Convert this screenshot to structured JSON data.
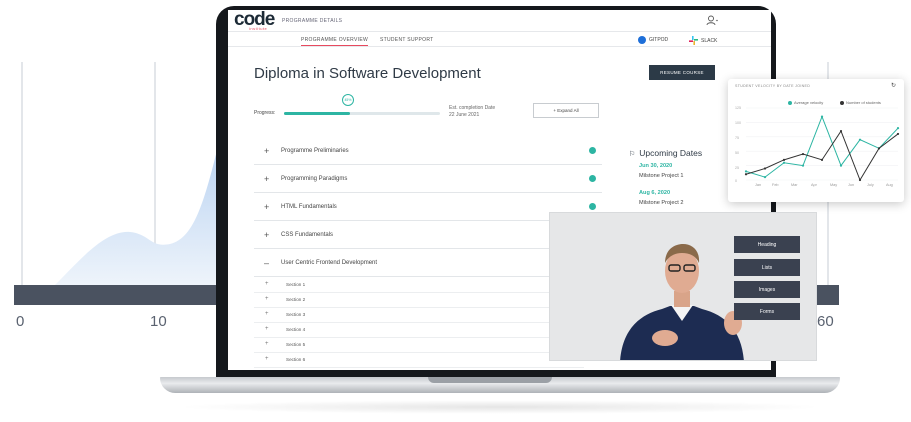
{
  "background_chart": {
    "axis_labels": [
      "0",
      "10",
      "60"
    ],
    "fill_color": "#c6d9f2",
    "band_color": "#4a5260"
  },
  "app": {
    "logo_text": "code",
    "logo_sub": "institute",
    "header_title": "PROGRAMME DETAILS",
    "user_icon": "user-icon"
  },
  "subnav": {
    "tabs": [
      "PROGRAMME OVERVIEW",
      "STUDENT SUPPORT"
    ],
    "active_tab": "PROGRAMME OVERVIEW",
    "gitpod": "GITPOD",
    "slack": "SLACK"
  },
  "main": {
    "title": "Diploma in Software Development",
    "resume_button": "RESUME COURSE",
    "progress_label": "Progress:",
    "progress_value": "45%",
    "progress_fraction": 0.42,
    "est_label": "Est. completion Date",
    "est_date": "22 June 2021",
    "expand_button": "+ Expand All",
    "modules": [
      {
        "name": "Programme Preliminaries",
        "complete": true
      },
      {
        "name": "Programming Paradigms",
        "complete": true
      },
      {
        "name": "HTML Fundamentals",
        "complete": true
      },
      {
        "name": "CSS Fundamentals",
        "complete": false
      },
      {
        "name": "User Centric Frontend Development",
        "complete": false,
        "expanded": true
      }
    ],
    "sections": [
      "Section 1",
      "Section 2",
      "Section 3",
      "Section 4",
      "Section 5",
      "Section 6"
    ]
  },
  "upcoming": {
    "title": "Upcoming Dates",
    "items": [
      {
        "date": "Jun 30, 2020",
        "label": "Milstone Project 1"
      },
      {
        "date": "Aug 6, 2020",
        "label": "Milstone Project 2"
      }
    ]
  },
  "velocity_card": {
    "title": "STUDENT VELOCITY BY DATE JOINED",
    "refresh_icon": "refresh-icon"
  },
  "chart_data": {
    "type": "line",
    "title": "STUDENT VELOCITY BY DATE JOINED",
    "categories": [
      "Jan",
      "Feb",
      "Mar",
      "Apr",
      "May",
      "Jun",
      "July",
      "Aug"
    ],
    "series": [
      {
        "name": "Average velocity",
        "color": "#2db5a3",
        "values": [
          15,
          5,
          30,
          25,
          110,
          25,
          70,
          55,
          90
        ]
      },
      {
        "name": "Number of students",
        "color": "#333333",
        "values": [
          10,
          20,
          35,
          45,
          35,
          85,
          0,
          55,
          80
        ]
      }
    ],
    "y_ticks": [
      "125",
      "100",
      "75",
      "50",
      "25",
      "0"
    ],
    "ylim": [
      0,
      125
    ],
    "legend_position": "top-right",
    "grid": true
  },
  "video": {
    "buttons": [
      "Heading",
      "Lists",
      "Images",
      "Forms"
    ]
  }
}
